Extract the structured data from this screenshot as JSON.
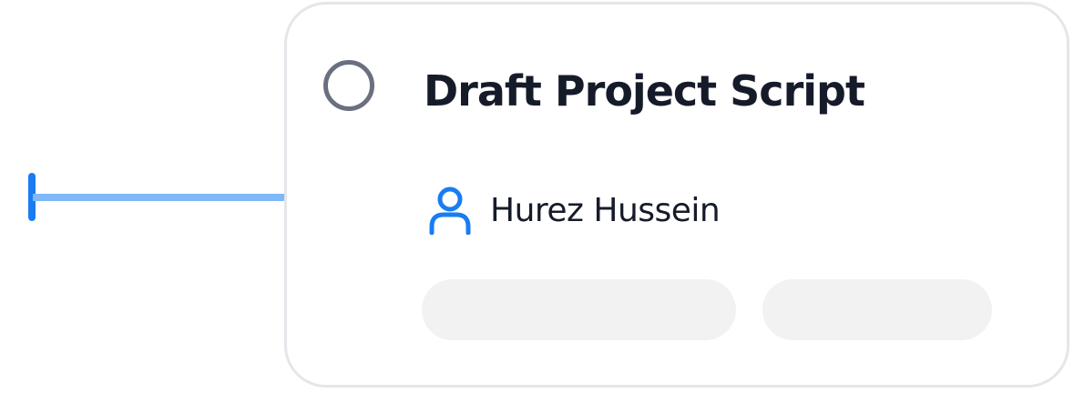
{
  "task": {
    "title": "Draft Project Script",
    "assignee": {
      "name": "Hurez Hussein",
      "icon": "person-icon"
    },
    "status": "not-started"
  },
  "colors": {
    "accent": "#1a7cf2",
    "connector": "#7fb9f7",
    "title_text": "#161b2a",
    "status_circle": "#6b7080",
    "card_border": "#e4e6ea",
    "placeholder": "#f2f2f2"
  }
}
